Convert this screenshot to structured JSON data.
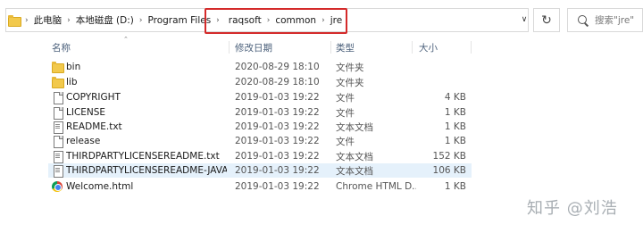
{
  "address_bar": {
    "crumbs": [
      "此电脑",
      "本地磁盘 (D:)",
      "Program Files",
      "raqsoft",
      "common",
      "jre"
    ],
    "separator": "›"
  },
  "search": {
    "placeholder": "搜索\"jre\""
  },
  "columns": {
    "name": "名称",
    "date": "修改日期",
    "type": "类型",
    "size": "大小"
  },
  "files": [
    {
      "name": "bin",
      "date": "2020-08-29 18:10",
      "type": "文件夹",
      "size": "",
      "icon": "folder-icon"
    },
    {
      "name": "lib",
      "date": "2020-08-29 18:10",
      "type": "文件夹",
      "size": "",
      "icon": "folder-icon"
    },
    {
      "name": "COPYRIGHT",
      "date": "2019-01-03 19:22",
      "type": "文件",
      "size": "4 KB",
      "icon": "file-icon"
    },
    {
      "name": "LICENSE",
      "date": "2019-01-03 19:22",
      "type": "文件",
      "size": "1 KB",
      "icon": "file-icon"
    },
    {
      "name": "README.txt",
      "date": "2019-01-03 19:22",
      "type": "文本文档",
      "size": "1 KB",
      "icon": "text-file-icon"
    },
    {
      "name": "release",
      "date": "2019-01-03 19:22",
      "type": "文件",
      "size": "1 KB",
      "icon": "file-icon"
    },
    {
      "name": "THIRDPARTYLICENSEREADME.txt",
      "date": "2019-01-03 19:22",
      "type": "文本文档",
      "size": "152 KB",
      "icon": "text-file-icon"
    },
    {
      "name": "THIRDPARTYLICENSEREADME-JAVAF...",
      "date": "2019-01-03 19:22",
      "type": "文本文档",
      "size": "106 KB",
      "icon": "text-file-icon",
      "selected": true
    },
    {
      "name": "Welcome.html",
      "date": "2019-01-03 19:22",
      "type": "Chrome HTML D...",
      "size": "1 KB",
      "icon": "chrome-html-icon"
    }
  ],
  "watermark": "知乎 @刘浩"
}
